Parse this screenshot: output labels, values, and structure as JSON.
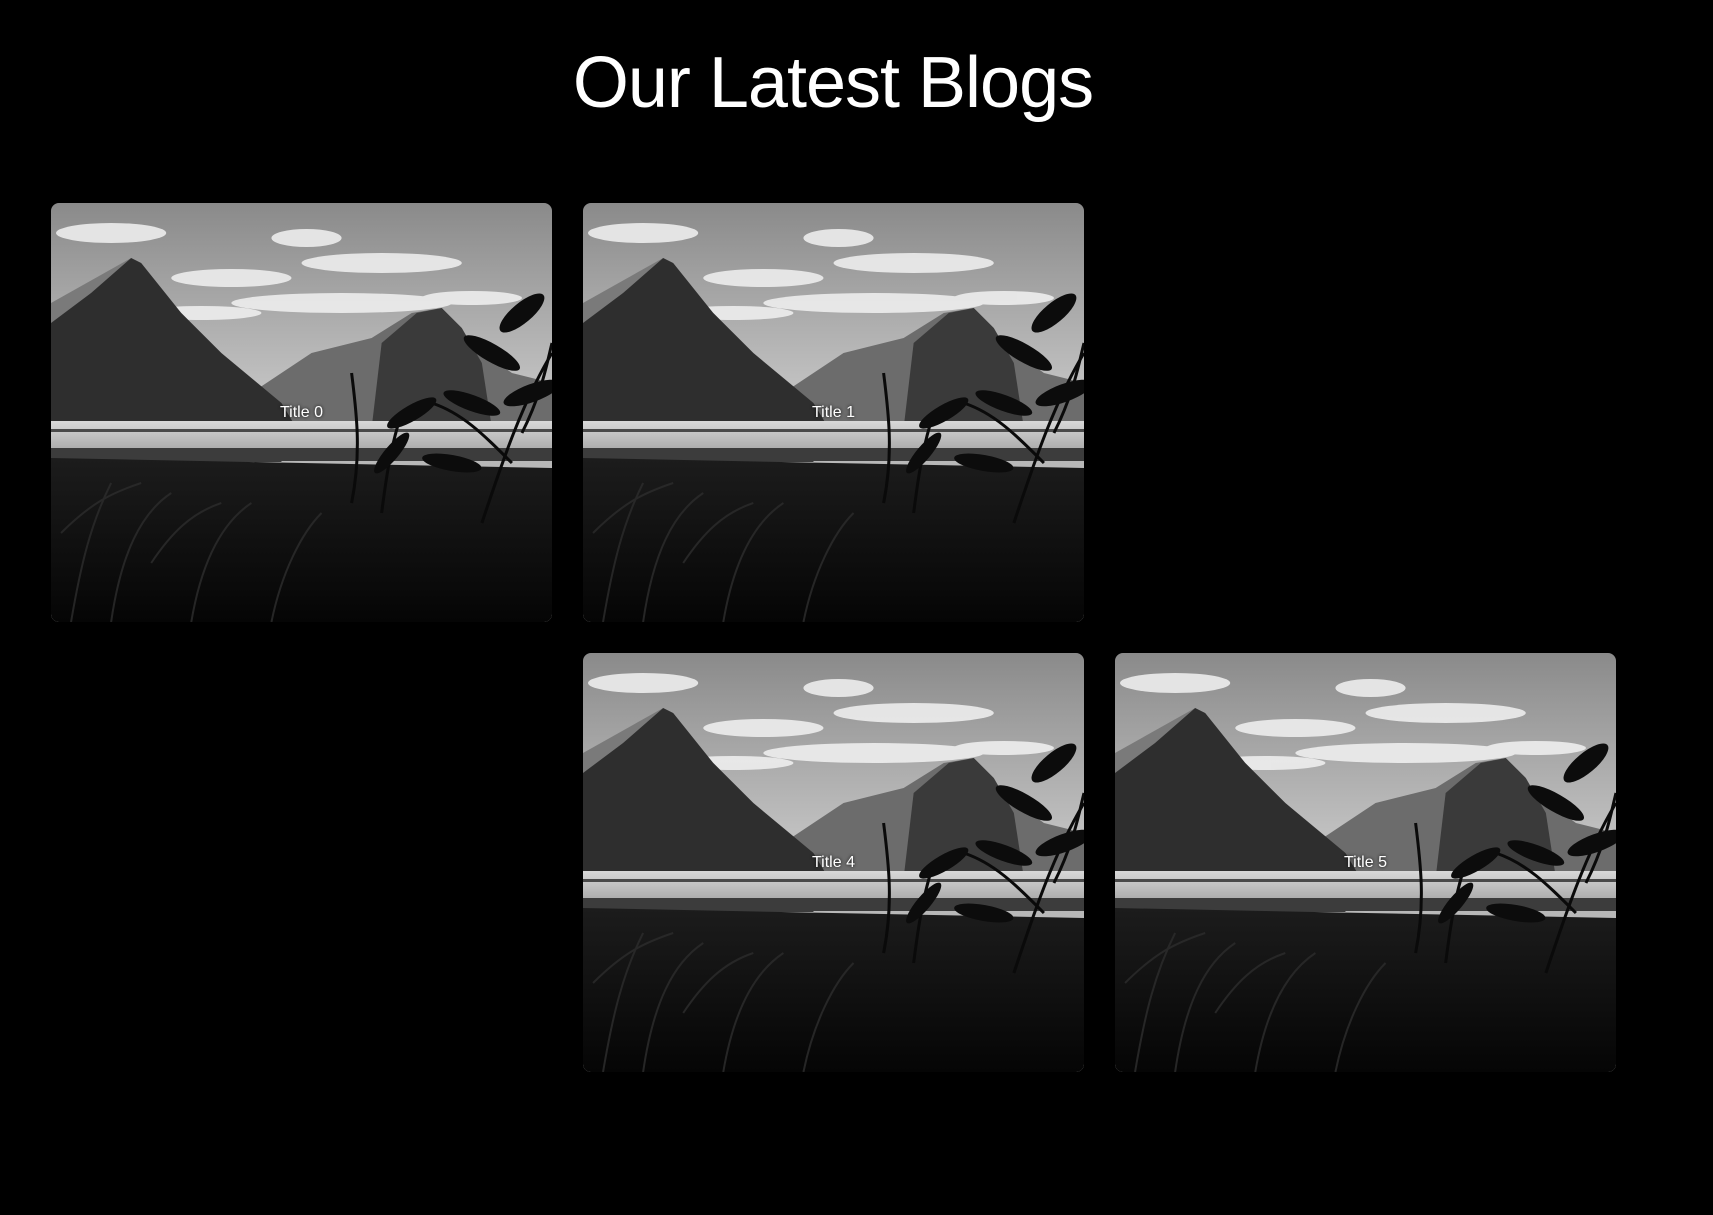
{
  "page": {
    "heading": "Our Latest Blogs"
  },
  "blogs": [
    {
      "title": "Title 0",
      "visible": true
    },
    {
      "title": "Title 1",
      "visible": true
    },
    {
      "title": "",
      "visible": false
    },
    {
      "title": "",
      "visible": false
    },
    {
      "title": "Title 4",
      "visible": true
    },
    {
      "title": "Title 5",
      "visible": true
    }
  ],
  "colors": {
    "background": "#000000",
    "text": "#ffffff"
  }
}
